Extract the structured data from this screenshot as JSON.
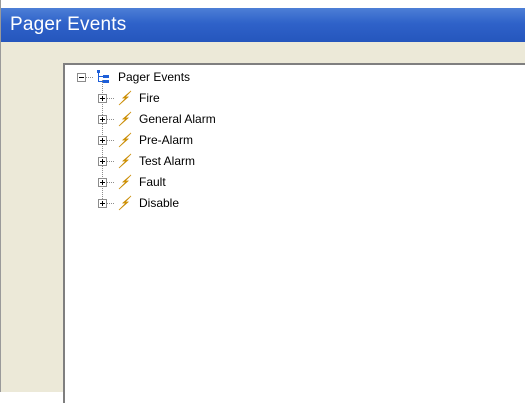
{
  "window": {
    "title": "Pager Events"
  },
  "tree": {
    "root": {
      "label": "Pager Events",
      "icon": "tree-structure-icon",
      "expander": "minus"
    },
    "items": [
      {
        "label": "Fire",
        "icon": "lightning-bolt-icon",
        "expander": "plus"
      },
      {
        "label": "General Alarm",
        "icon": "lightning-bolt-icon",
        "expander": "plus"
      },
      {
        "label": "Pre-Alarm",
        "icon": "lightning-bolt-icon",
        "expander": "plus"
      },
      {
        "label": "Test Alarm",
        "icon": "lightning-bolt-icon",
        "expander": "plus"
      },
      {
        "label": "Fault",
        "icon": "lightning-bolt-icon",
        "expander": "plus"
      },
      {
        "label": "Disable",
        "icon": "lightning-bolt-icon",
        "expander": "plus"
      }
    ]
  },
  "colors": {
    "titlebar": "#2f62c9",
    "panel": "#ece9d8",
    "bolt": "#f2c21a"
  }
}
